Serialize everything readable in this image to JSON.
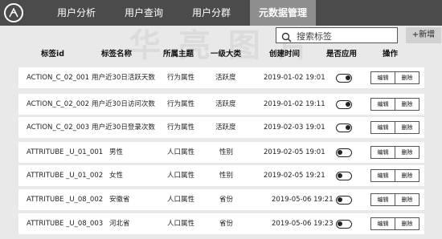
{
  "nav": {
    "items": [
      {
        "label": "用户分析",
        "active": false
      },
      {
        "label": "用户查询",
        "active": false
      },
      {
        "label": "用户分群",
        "active": false
      },
      {
        "label": "元数据管理",
        "active": true
      }
    ]
  },
  "watermark": "华 亮 图 片",
  "search": {
    "placeholder": "搜索标签"
  },
  "add_button": "+新增",
  "table": {
    "headers": [
      "标签id",
      "标签名称",
      "所属主题",
      "一级大类",
      "创建时间",
      "是否应用",
      "操作"
    ],
    "rows": [
      {
        "id": "ACTION_C_02_001",
        "name": "用户近30日活跃天数",
        "theme": "行为属性",
        "category": "活跃度",
        "created": "2019-01-02 19:01",
        "enabled": true
      },
      {
        "id": "ACTION_C_02_002",
        "name": "用户近30日访问次数",
        "theme": "行为属性",
        "category": "活跃度",
        "created": "2019-01-02 19:11",
        "enabled": true
      },
      {
        "id": "ACTION_C_02_003",
        "name": "用户近30日登录次数",
        "theme": "行为属性",
        "category": "活跃度",
        "created": "2019-02-03 19:01",
        "enabled": true
      },
      {
        "id": "ATTRITUBE _U_01_001",
        "name": "男性",
        "theme": "人口属性",
        "category": "性别",
        "created": "2019-02-05 19:01",
        "enabled": false
      },
      {
        "id": "ATTRITUBE _U_01_002",
        "name": "女性",
        "theme": "人口属性",
        "category": "性别",
        "created": "2019-02-05 19:21",
        "enabled": false
      },
      {
        "id": "ATTRITUBE _U_08_002",
        "name": "安徽省",
        "theme": "人口属性",
        "category": "省份",
        "created": "2019-05-06 19:21",
        "enabled": false
      },
      {
        "id": "ATTRITUBE _U_08_003",
        "name": "河北省",
        "theme": "人口属性",
        "category": "省份",
        "created": "2019-05-06 19:23",
        "enabled": false
      }
    ],
    "actions": {
      "edit": "编辑",
      "delete": "删除"
    }
  }
}
